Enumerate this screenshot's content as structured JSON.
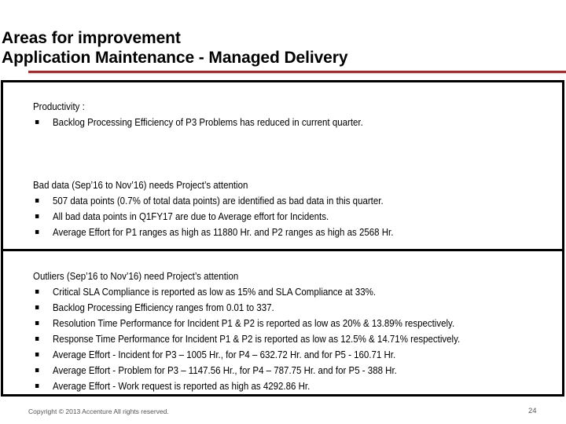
{
  "header": {
    "title_line1": "Areas for improvement",
    "title_line2": "Application Maintenance - Managed Delivery",
    "accent_color": "#9b2f2f"
  },
  "sections": [
    {
      "heading": "Productivity :",
      "bullets": [
        "Backlog Processing Efficiency of P3 Problems has reduced in current quarter."
      ]
    },
    {
      "heading": "Bad data (Sep’16 to Nov’16) needs Project’s attention",
      "bullets": [
        "507 data points (0.7% of total data points) are identified as bad data in this quarter.",
        "All bad data points in Q1FY17 are due to Average effort for Incidents.",
        "Average Effort for P1 ranges as high as 11880 Hr. and P2 ranges as high as 2568 Hr."
      ]
    },
    {
      "heading": "Outliers (Sep’16 to Nov’16) need Project’s attention",
      "bullets": [
        "Critical SLA Compliance is reported as low as 15% and SLA Compliance at 33%.",
        "Backlog Processing Efficiency ranges from 0.01 to 337.",
        "Resolution Time Performance for Incident P1 & P2 is reported as low as 20% & 13.89% respectively.",
        "Response Time Performance for Incident P1 & P2  is reported as low as 12.5% & 14.71% respectively.",
        "Average Effort - Incident for P3 – 1005 Hr., for P4 – 632.72 Hr. and for P5  - 160.71 Hr.",
        "Average Effort - Problem for P3 – 1147.56 Hr., for P4 – 787.75 Hr. and for P5  - 388 Hr.",
        "Average Effort - Work request is reported as high as 4292.86 Hr."
      ]
    }
  ],
  "bullet_glyph": "▪",
  "footer": {
    "copyright": "Copyright © 2013 Accenture  All rights reserved.",
    "page_number": "24"
  }
}
